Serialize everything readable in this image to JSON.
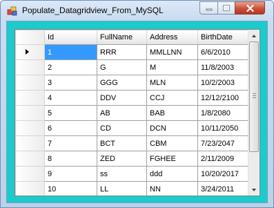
{
  "window": {
    "title": "Populate_Datagridview_From_MySQL",
    "controls": {
      "minimize_icon": "minimize-icon",
      "maximize_icon": "maximize-icon",
      "close_icon": "close-icon"
    }
  },
  "colors": {
    "client_background": "#1CCBCB",
    "selection": "#3399FF",
    "close_button": "#C9503A"
  },
  "grid": {
    "columns": [
      "Id",
      "FullName",
      "Address",
      "BirthDate"
    ],
    "current_row_index": 0,
    "rows": [
      [
        "1",
        "RRR",
        "MMLLNN",
        "6/6/2010"
      ],
      [
        "2",
        "G",
        "M",
        "11/8/2003"
      ],
      [
        "3",
        "GGG",
        "MLN",
        "10/2/2003"
      ],
      [
        "4",
        "DDV",
        "CCJ",
        "12/12/2100"
      ],
      [
        "5",
        "AB",
        "BAB",
        "1/8/2080"
      ],
      [
        "6",
        "CD",
        "DCN",
        "10/11/2050"
      ],
      [
        "7",
        "BCT",
        "CBM",
        "7/23/2047"
      ],
      [
        "8",
        "ZED",
        "FGHEE",
        "2/11/2009"
      ],
      [
        "9",
        "ss",
        "ddd",
        "10/20/2017"
      ],
      [
        "10",
        "LL",
        "NN",
        "3/24/2011"
      ]
    ]
  }
}
